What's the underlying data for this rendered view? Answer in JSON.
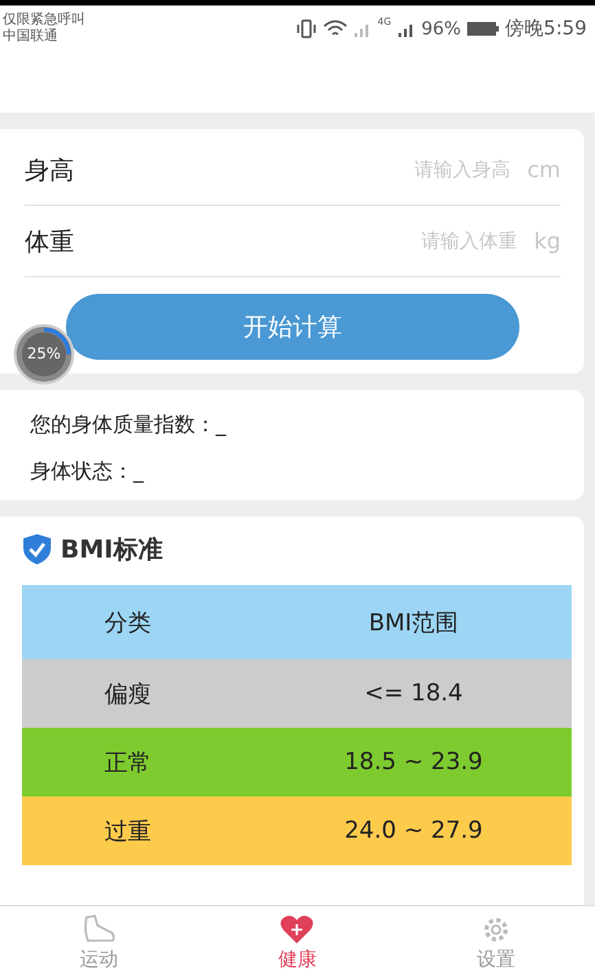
{
  "status_bar": {
    "carrier_lines": [
      "仅限紧急呼叫",
      "中国联通"
    ],
    "network_label": "4G",
    "battery_percent": "96%",
    "time": "傍晚5:59"
  },
  "input_card": {
    "fields": [
      {
        "label": "身高",
        "placeholder": "请输入身高",
        "unit": "cm"
      },
      {
        "label": "体重",
        "placeholder": "请输入体重",
        "unit": "kg"
      }
    ],
    "button": "开始计算"
  },
  "floating_badge": {
    "text": "25%",
    "level": 0.25
  },
  "result_card": {
    "lines": [
      "您的身体质量指数：_",
      "身体状态：_"
    ]
  },
  "bmi_card": {
    "title": "BMI标准",
    "columns": [
      "分类",
      "BMI范围"
    ],
    "rows": [
      {
        "category": "偏瘦",
        "range": "<= 18.4",
        "color": "#cccccc"
      },
      {
        "category": "正常",
        "range": "18.5 ~ 23.9",
        "color": "#7ecb2f"
      },
      {
        "category": "过重",
        "range": "24.0 ~ 27.9",
        "color": "#fdcb4c"
      }
    ]
  },
  "tab_bar": {
    "tabs": [
      {
        "label": "运动",
        "kind": "shoe",
        "selected": false
      },
      {
        "label": "健康",
        "kind": "heart",
        "selected": true
      },
      {
        "label": "设置",
        "kind": "gear",
        "selected": false
      }
    ]
  }
}
